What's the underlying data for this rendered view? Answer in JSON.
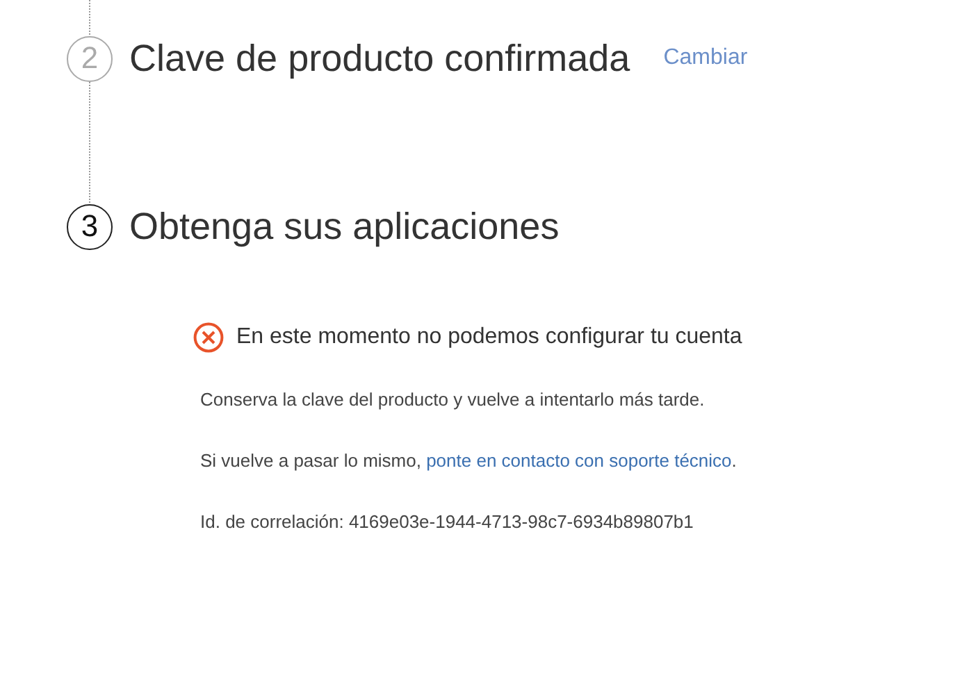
{
  "steps": [
    {
      "number": "2",
      "title": "Clave de producto confirmada",
      "active": false,
      "action": "Cambiar"
    },
    {
      "number": "3",
      "title": "Obtenga sus aplicaciones",
      "active": true
    }
  ],
  "error": {
    "title": "En este momento no podemos configurar tu cuenta",
    "paragraphs": [
      {
        "text": "Conserva la clave del producto y vuelve a intentarlo más tarde."
      },
      {
        "text": "Si vuelve a pasar lo mismo, ",
        "link": "ponte en contacto con soporte técnico",
        "after": "."
      },
      {
        "text": "Id. de correlación: 4169e03e-1944-4713-98c7-6934b89807b1"
      }
    ]
  }
}
